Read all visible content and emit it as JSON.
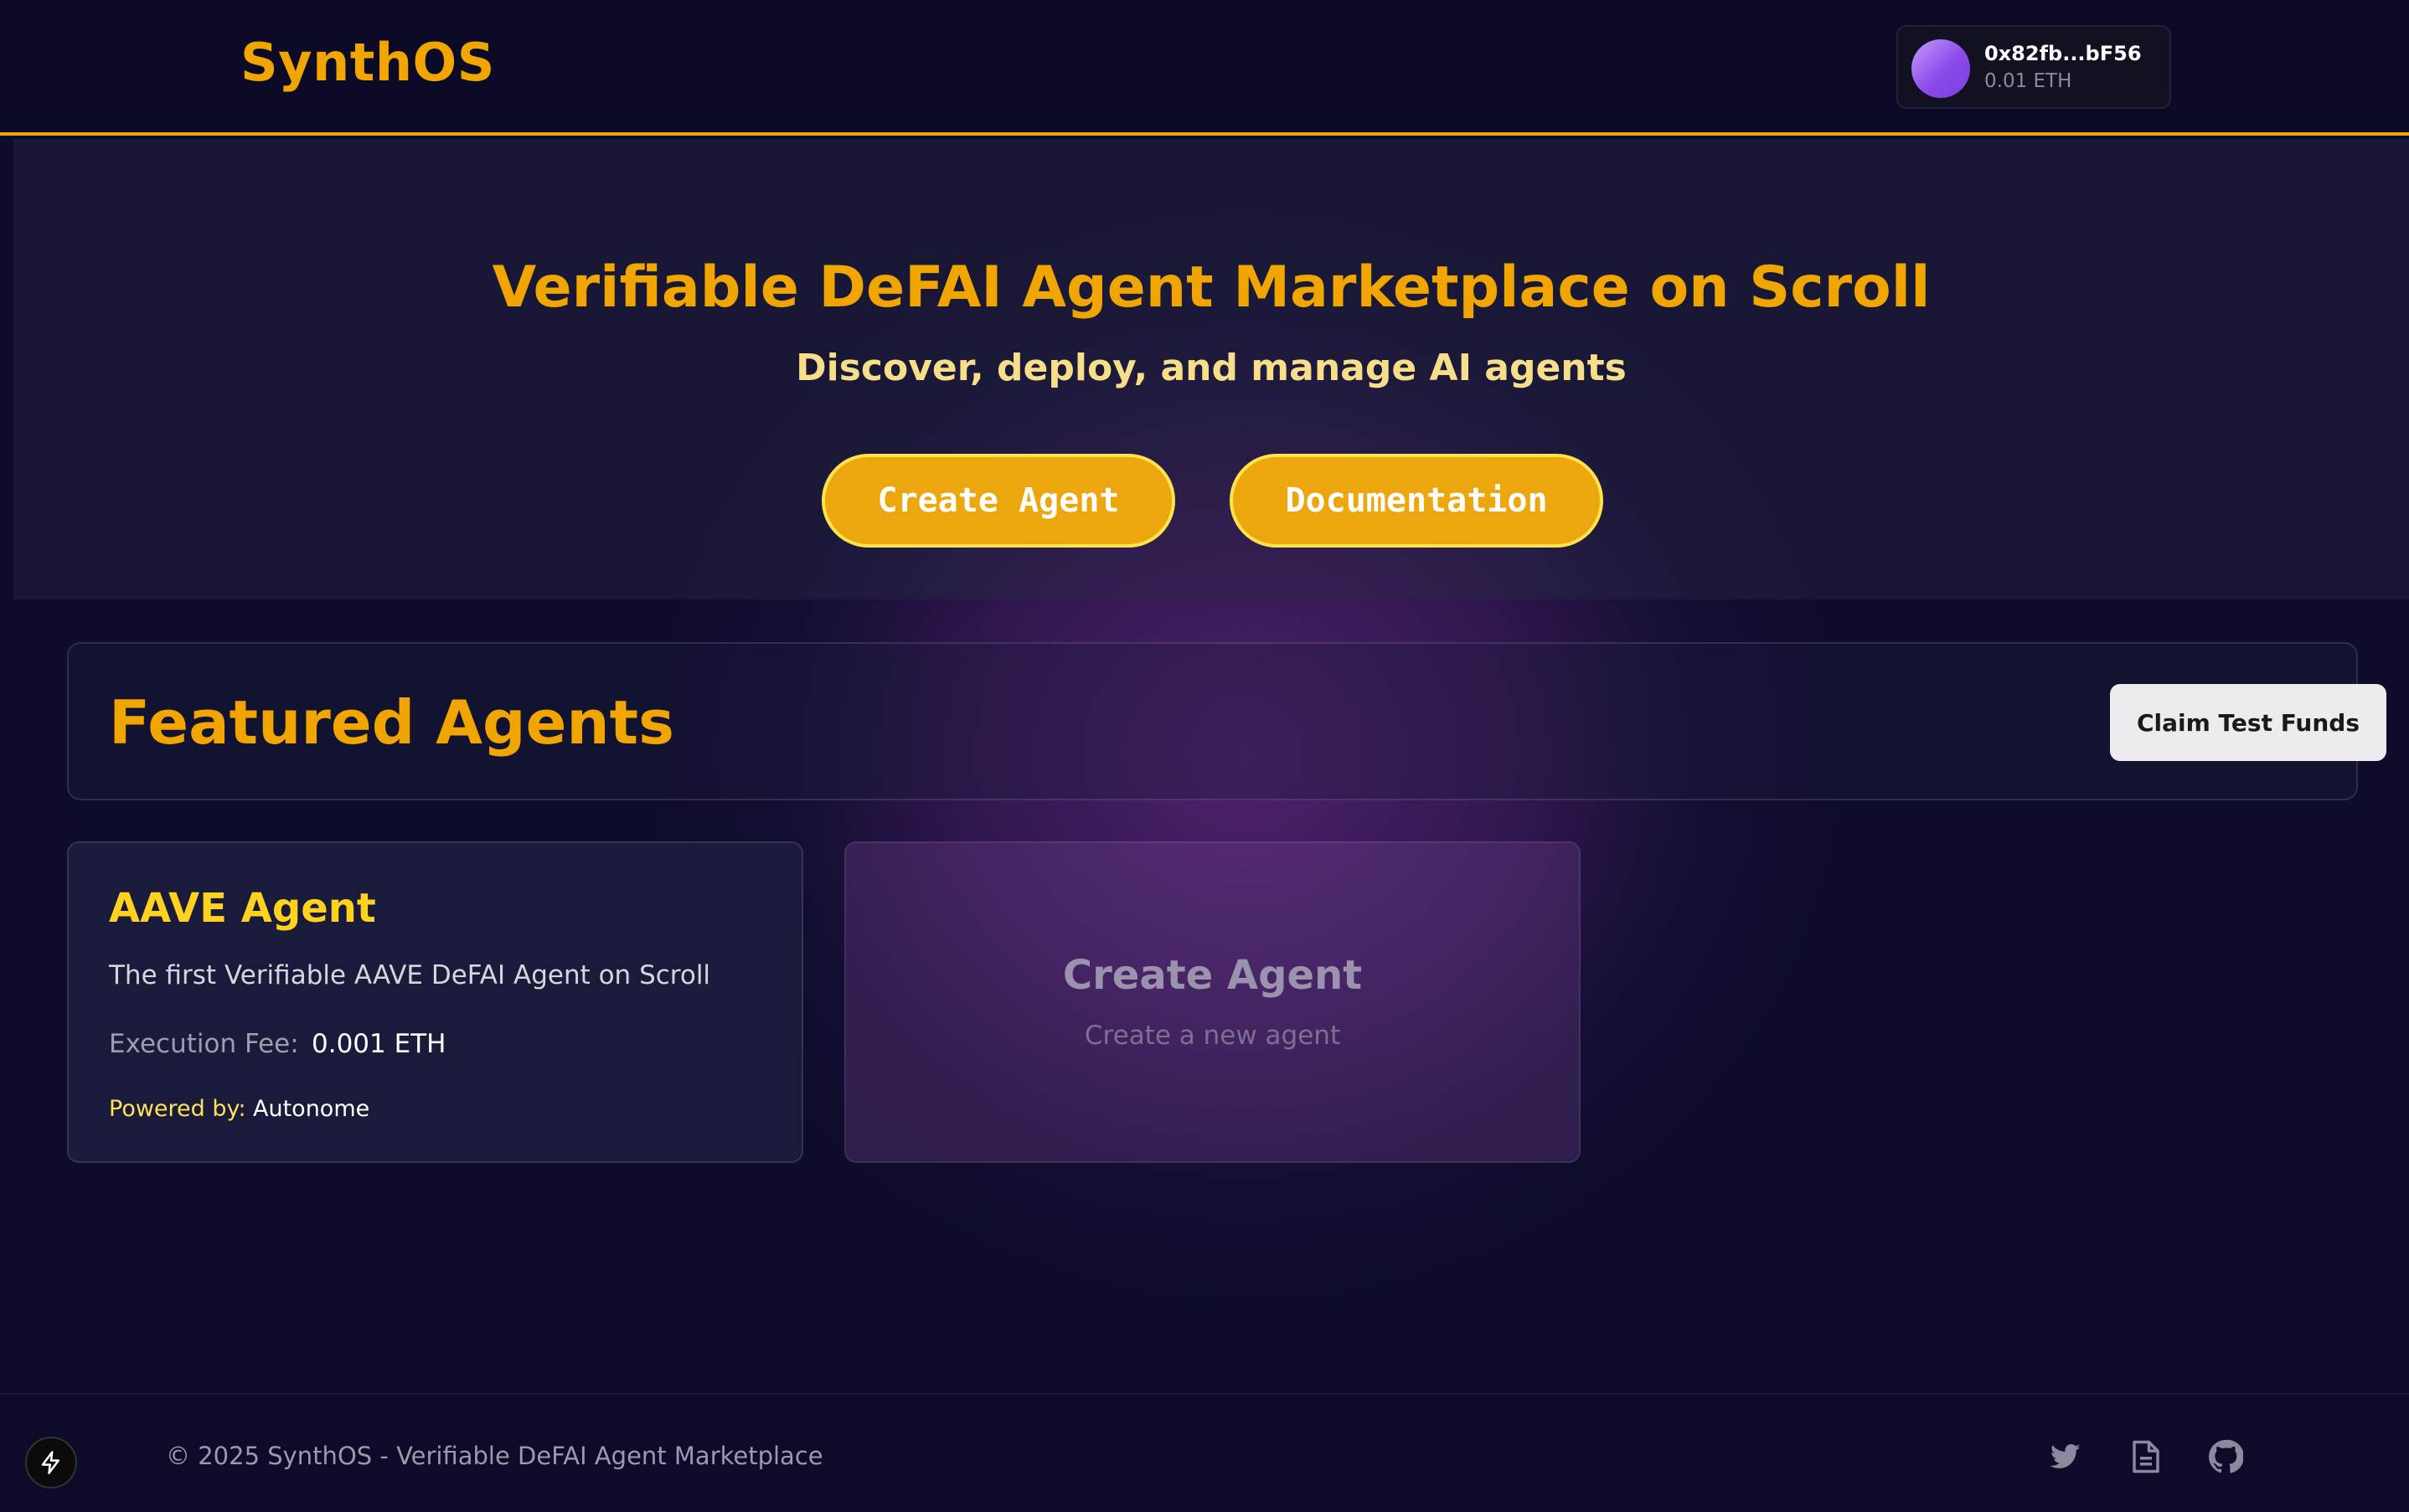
{
  "app": {
    "logo": "SynthOS"
  },
  "wallet": {
    "address": "0x82fb...bF56",
    "balance": "0.01 ETH"
  },
  "hero": {
    "title": "Verifiable DeFAI Agent Marketplace on Scroll",
    "subtitle": "Discover, deploy, and manage AI agents",
    "buttons": {
      "create": "Create Agent",
      "docs": "Documentation"
    }
  },
  "featured": {
    "title": "Featured Agents",
    "claim_button": "Claim Test Funds"
  },
  "agents": [
    {
      "name": "AAVE Agent",
      "description": "The first Verifiable AAVE DeFAI Agent on Scroll",
      "fee_label": "Execution Fee:",
      "fee_value": "0.001 ETH",
      "powered_label": "Powered by:",
      "powered_value": "Autonome"
    }
  ],
  "create_card": {
    "title": "Create Agent",
    "subtitle": "Create a new agent"
  },
  "footer": {
    "copyright": "© 2025 SynthOS - Verifiable DeFAI Agent Marketplace",
    "icons": [
      "lightning-icon",
      "twitter-icon",
      "document-icon",
      "github-icon"
    ]
  },
  "colors": {
    "accent": "#f0a500",
    "accent_border": "#ffe34d",
    "agent_name": "#ffd21f",
    "background": "#0d0d2b",
    "glow": "#7a2d96"
  }
}
